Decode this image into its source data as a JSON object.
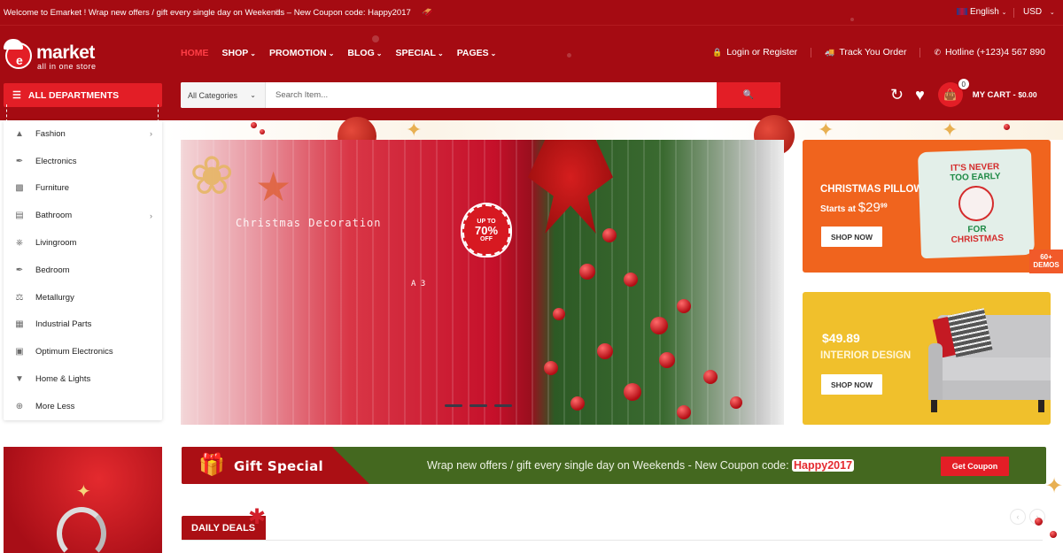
{
  "topbar": {
    "welcome": "Welcome to Emarket ! Wrap new offers / gift every single day on Weekends – New Coupon code: Happy2017",
    "language": "English",
    "currency": "USD"
  },
  "logo": {
    "name": "market",
    "tagline": "all in one store"
  },
  "nav": {
    "items": [
      {
        "label": "HOME",
        "active": true,
        "has_dropdown": false
      },
      {
        "label": "SHOP",
        "has_dropdown": true
      },
      {
        "label": "PROMOTION",
        "has_dropdown": true
      },
      {
        "label": "BLOG",
        "has_dropdown": true
      },
      {
        "label": "SPECIAL",
        "has_dropdown": true
      },
      {
        "label": "PAGES",
        "has_dropdown": true
      }
    ]
  },
  "header_links": {
    "login": "Login or Register",
    "track": "Track You Order",
    "hotline": "Hotline (+123)4 567 890"
  },
  "departments": {
    "button_label": "ALL DEPARTMENTS",
    "items": [
      {
        "label": "Fashion",
        "icon": "dress-icon",
        "has_submenu": true
      },
      {
        "label": "Electronics",
        "icon": "plug-icon",
        "has_submenu": false
      },
      {
        "label": "Furniture",
        "icon": "wallet-icon",
        "has_submenu": false
      },
      {
        "label": "Bathroom",
        "icon": "bathroom-icon",
        "has_submenu": true
      },
      {
        "label": "Livingroom",
        "icon": "chair-icon",
        "has_submenu": false
      },
      {
        "label": "Bedroom",
        "icon": "plug-icon",
        "has_submenu": false
      },
      {
        "label": "Metallurgy",
        "icon": "flask-icon",
        "has_submenu": false
      },
      {
        "label": "Industrial Parts",
        "icon": "factory-icon",
        "has_submenu": false
      },
      {
        "label": "Optimum Electronics",
        "icon": "camera-icon",
        "has_submenu": false
      },
      {
        "label": "Home & Lights",
        "icon": "lamp-icon",
        "has_submenu": false
      },
      {
        "label": "More Less",
        "icon": "plus-circle-icon",
        "has_submenu": false
      }
    ]
  },
  "search": {
    "category": "All Categories",
    "placeholder": "Search Item..."
  },
  "cart": {
    "count": "0",
    "label": "MY CART - ",
    "total": "$0.00"
  },
  "slider": {
    "caption": "Christmas Decoration",
    "small_text": "A 3",
    "badge_line1": "UP TO",
    "badge_line2": "70%",
    "badge_line3": "OFF",
    "slide_count": 3
  },
  "banners": [
    {
      "title": "CHRISTMAS PILLOW",
      "sub_prefix": "Starts at ",
      "price_main": "$29",
      "price_cents": "99",
      "button": "SHOP NOW",
      "color": "#f0641e",
      "pillow_line1": "IT'S NEVER",
      "pillow_line2": "TOO EARLY",
      "pillow_line3": "FOR",
      "pillow_line4": "CHRISTMAS"
    },
    {
      "price": "$49.89",
      "title": "INTERIOR DESIGN",
      "button": "SHOP NOW",
      "color": "#f0c02c"
    }
  ],
  "demos_badge": {
    "line1": "60+",
    "line2": "DEMOS"
  },
  "gift_bar": {
    "title": "Gift Special",
    "text": "Wrap new offers / gift every single day on Weekends - New Coupon code: ",
    "code": "Happy2017",
    "button": "Get Coupon"
  },
  "daily_deals": {
    "title": "DAILY DEALS"
  },
  "colors": {
    "header_bg": "#a50b12",
    "accent": "#e31e26",
    "gift_green": "#44681f"
  }
}
